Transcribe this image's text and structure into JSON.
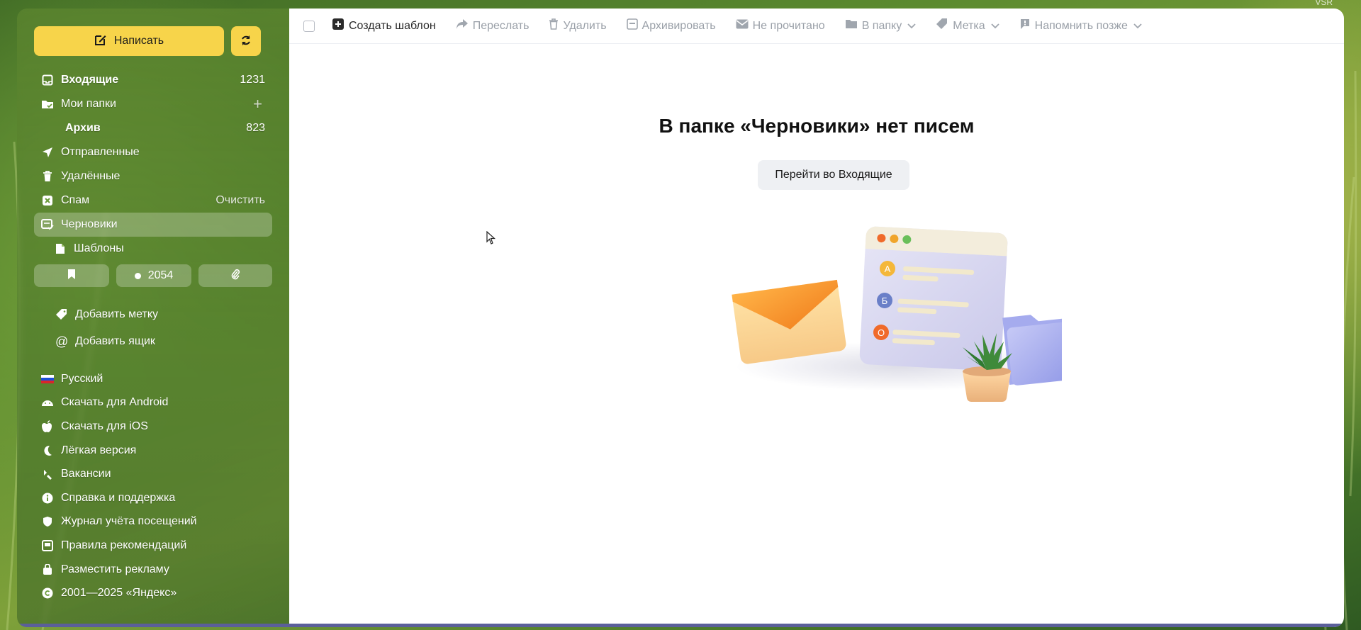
{
  "corner_label": "VSR",
  "sidebar": {
    "compose_label": "Написать",
    "folders": [
      {
        "label": "Входящие",
        "count": "1231",
        "icon": "inbox-icon"
      },
      {
        "label": "Мои папки",
        "icon": "folder-icon"
      },
      {
        "label": "Архив",
        "count": "823"
      },
      {
        "label": "Отправленные",
        "icon": "send-icon"
      },
      {
        "label": "Удалённые",
        "icon": "trash-icon"
      },
      {
        "label": "Спам",
        "action": "Очистить",
        "icon": "spam-icon"
      },
      {
        "label": "Черновики",
        "icon": "drafts-icon"
      },
      {
        "label": "Шаблоны",
        "icon": "template-icon"
      }
    ],
    "filters": {
      "unread_count": "2054"
    },
    "add_label": "Добавить метку",
    "add_mailbox": "Добавить ящик",
    "footer": [
      {
        "label": "Русский",
        "icon": "russia-flag-icon"
      },
      {
        "label": "Скачать для Android",
        "icon": "android-icon"
      },
      {
        "label": "Скачать для iOS",
        "icon": "apple-icon"
      },
      {
        "label": "Лёгкая версия",
        "icon": "moon-icon"
      },
      {
        "label": "Вакансии",
        "icon": "job-icon"
      },
      {
        "label": "Справка и поддержка",
        "icon": "info-icon"
      },
      {
        "label": "Журнал учёта посещений",
        "icon": "shield-icon"
      },
      {
        "label": "Правила рекомендаций",
        "icon": "rules-icon"
      },
      {
        "label": "Разместить рекламу",
        "icon": "ad-bag-icon"
      },
      {
        "label": "2001—2025 «Яндекс»",
        "icon": "copyright-icon"
      }
    ]
  },
  "toolbar": {
    "create_template": "Создать шаблон",
    "forward": "Переслать",
    "delete": "Удалить",
    "archive": "Архивировать",
    "unread": "Не прочитано",
    "to_folder": "В папку",
    "label": "Метка",
    "remind_later": "Напомнить позже"
  },
  "main": {
    "empty_title": "В папке «Черновики» нет писем",
    "goto_inbox": "Перейти во Входящие",
    "illustration_letters": [
      "A",
      "Б",
      "О"
    ]
  },
  "colors": {
    "accent_yellow": "#f7d44a",
    "sidebar_green": "#5b8a2f",
    "main_bg": "#ffffff"
  }
}
